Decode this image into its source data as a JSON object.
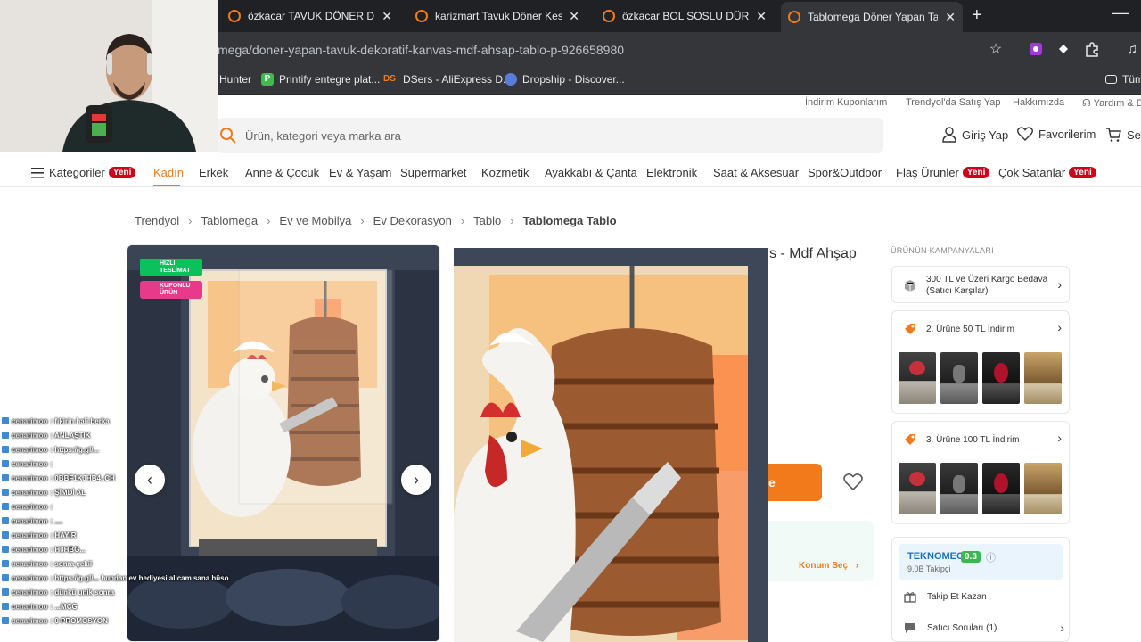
{
  "browser": {
    "tabs": [
      {
        "title": "özkacar TAVUK DÖNER DÜRÜM",
        "active": false
      },
      {
        "title": "karizmart Tavuk Döner Kesen U",
        "active": false
      },
      {
        "title": "özkacar BOL SOSLU DÜRÜMLE",
        "active": false
      },
      {
        "title": "Tablomega Döner Yapan Tavuk",
        "active": true
      }
    ],
    "new_tab": "+",
    "close_glyph": "✕",
    "minimize_glyph": "—",
    "url": "mega/doner-yapan-tavuk-dekoratif-kanvas-mdf-ahsap-tablo-p-926658980",
    "bookmarks": [
      {
        "label": "Hunter",
        "icon": ""
      },
      {
        "label": "Printify entegre plat...",
        "icon": "P"
      },
      {
        "label": "DSers - AliExpress D...",
        "icon": "DS"
      },
      {
        "label": "Dropship - Discover...",
        "icon": ""
      },
      {
        "label": "Tüm",
        "icon": ""
      }
    ]
  },
  "site": {
    "top_links": [
      "İndirim Kuponlarım",
      "Trendyol'da Satış Yap",
      "Hakkımızda",
      "Yardım & D"
    ],
    "search_placeholder": "Ürün, kategori veya marka ara",
    "login": "Giriş Yap",
    "favorites": "Favorilerim",
    "cart": "Sep",
    "categories_label": "Kategoriler",
    "new_badge": "Yeni",
    "categories": [
      "Kadın",
      "Erkek",
      "Anne & Çocuk",
      "Ev & Yaşam",
      "Süpermarket",
      "Kozmetik",
      "Ayakkabı & Çanta",
      "Elektronik",
      "Saat & Aksesuar",
      "Spor&Outdoor",
      "Flaş Ürünler",
      "Çok Satanlar"
    ],
    "breadcrumb": [
      "Trendyol",
      "Tablomega",
      "Ev ve Mobilya",
      "Ev Dekorasyon",
      "Tablo",
      "Tablomega Tablo"
    ],
    "breadcrumb_sep": "›"
  },
  "product": {
    "badge_fast": "HIZLI TESLİMAT",
    "badge_coupon": "KUPONLU ÜRÜN",
    "title_fragment": "s - Mdf Ahşap",
    "cart_fragment": "e",
    "location_button": "Konum Seç",
    "prev_glyph": "‹",
    "next_glyph": "›"
  },
  "campaigns": {
    "title": "ÜRÜNÜN KAMPANYALARI",
    "items": [
      {
        "label": "300 TL ve Üzeri Kargo Bedava (Satıcı Karşılar)"
      },
      {
        "label": "2. Ürüne 50 TL İndirim"
      },
      {
        "label": "3. Ürüne 100 TL İndirim"
      }
    ],
    "chevron": "›"
  },
  "seller": {
    "name": "TEKNOMEG",
    "score": "9.3",
    "followers": "9,0B Takipçi",
    "follow_earn": "Takip Et Kazan",
    "questions": "Satıcı Soruları (1)"
  },
  "chat": [
    {
      "user": "cenarimoo",
      "msg": ": fıkirin hali berka"
    },
    {
      "user": "cenarimoo",
      "msg": ": ANLAŞTIK"
    },
    {
      "user": "cenarimoo",
      "msg": ": https://g.gl/..."
    },
    {
      "user": "cenarimoo",
      "msg": ":"
    },
    {
      "user": "cenarimoo",
      "msg": ": 0BBF1KJHB4..CH"
    },
    {
      "user": "cenarimoo",
      "msg": ": ŞİMDİ AL"
    },
    {
      "user": "cenarimoo",
      "msg": ":"
    },
    {
      "user": "cenarimoo",
      "msg": ": ...."
    },
    {
      "user": "cenarimoo",
      "msg": ": HAYIR"
    },
    {
      "user": "cenarimoo",
      "msg": ": H0HBG..."
    },
    {
      "user": "cenarimoo",
      "msg": ": sonra çekil"
    },
    {
      "user": "cenarimoo",
      "msg": ": https://g.gl/... bundan ev hediyesi alıcam sana hüso"
    },
    {
      "user": "cenarimoo",
      "msg": ": dünkü unik sonra"
    },
    {
      "user": "cenarimoo",
      "msg": ": ...MCG"
    },
    {
      "user": "cenarimoo",
      "msg": ": 0 PROMOSYON"
    }
  ],
  "colors": {
    "accent": "#f27a1a",
    "badge_red": "#d0021b",
    "fast_green": "#0bc15c",
    "coupon_pink": "#e8398b"
  }
}
